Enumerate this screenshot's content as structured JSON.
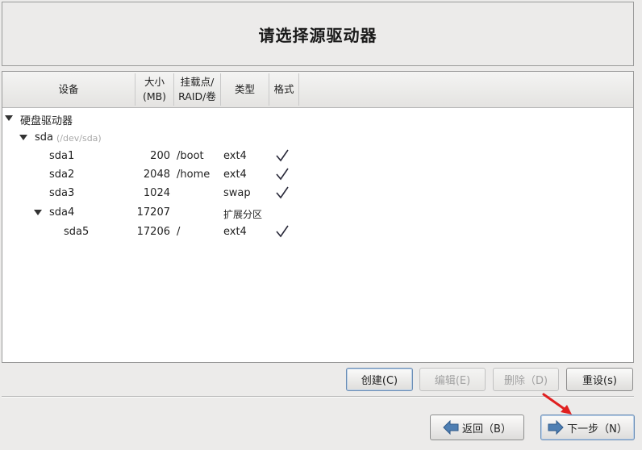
{
  "header": {
    "title": "请选择源驱动器"
  },
  "table": {
    "columns": {
      "device": "设备",
      "size_line1": "大小",
      "size_line2": "(MB)",
      "mount_line1": "挂载点/",
      "mount_line2": "RAID/卷",
      "type": "类型",
      "format": "格式"
    },
    "rows": {
      "group": {
        "label": "硬盘驱动器"
      },
      "sda": {
        "label": "sda",
        "path": "(/dev/sda)"
      },
      "sda1": {
        "device": "sda1",
        "size": "200",
        "mount": "/boot",
        "type": "ext4",
        "format": true
      },
      "sda2": {
        "device": "sda2",
        "size": "2048",
        "mount": "/home",
        "type": "ext4",
        "format": true
      },
      "sda3": {
        "device": "sda3",
        "size": "1024",
        "mount": "",
        "type": "swap",
        "format": true
      },
      "sda4": {
        "device": "sda4",
        "size": "17207",
        "mount": "",
        "type": "扩展分区",
        "format": false
      },
      "sda5": {
        "device": "sda5",
        "size": "17206",
        "mount": "/",
        "type": "ext4",
        "format": true
      }
    }
  },
  "actions": {
    "create": "创建(C)",
    "edit": "编辑(E)",
    "delete": "删除（D)",
    "reset": "重设(s)"
  },
  "nav": {
    "back": "返回（B）",
    "next": "下一步（N）"
  },
  "icons": {
    "expand": "triangle-down-icon",
    "format": "checkmark-icon",
    "back": "left-arrow-icon",
    "next": "right-arrow-icon",
    "cursor": "red-arrow-cursor-icon"
  },
  "colors": {
    "arrow_blue": "#4f7fb3",
    "cursor_red": "#e02020"
  }
}
